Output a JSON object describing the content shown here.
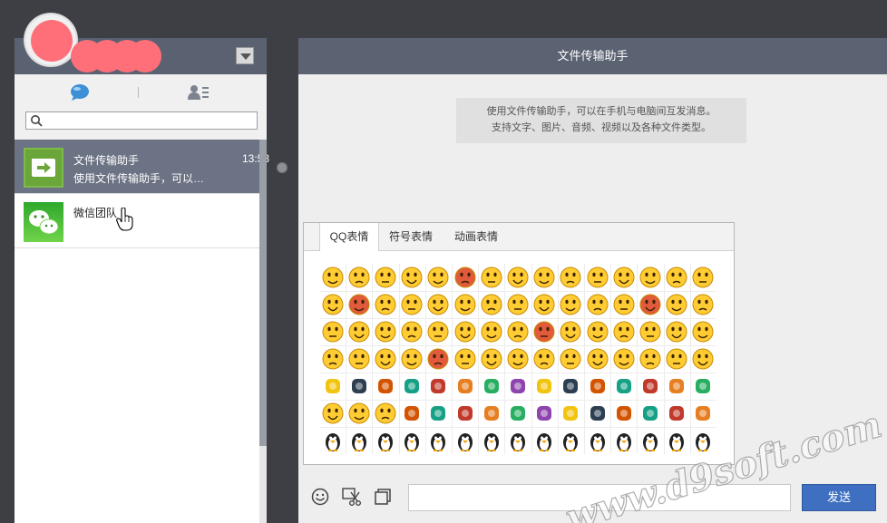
{
  "sidebar": {
    "search": {
      "placeholder": "",
      "value": ""
    },
    "chats": [
      {
        "title": "文件传输助手",
        "time": "13:53",
        "preview": "使用文件传输助手，可以…",
        "selected": true,
        "icon": "file-transfer-icon"
      },
      {
        "title": "微信团队",
        "time": "",
        "preview": "",
        "selected": false,
        "icon": "wechat-logo-icon"
      }
    ]
  },
  "chat": {
    "title": "文件传输助手",
    "notice_line1": "使用文件传输助手，可以在手机与电脑间互发消息。",
    "notice_line2": "支持文字、图片、音频、视频以及各种文件类型。"
  },
  "emoji_panel": {
    "tabs": [
      "QQ表情",
      "符号表情",
      "动画表情"
    ],
    "active_tab": 0,
    "rows": 7,
    "cols": 15
  },
  "input_bar": {
    "message_value": "",
    "send_label": "发送"
  },
  "watermark": {
    "text": "www.d9soft.com"
  },
  "colors": {
    "accent": "#3f6fc1",
    "header": "#5b6372",
    "selected_row": "#6b7384"
  }
}
